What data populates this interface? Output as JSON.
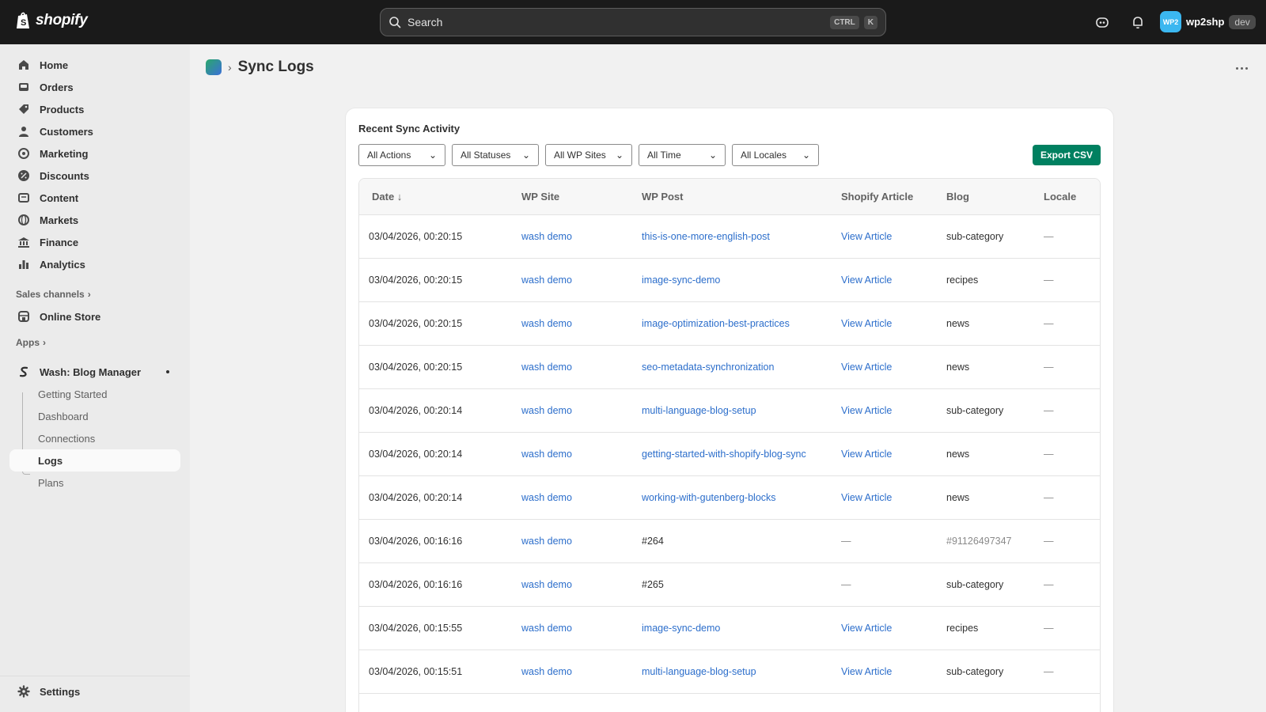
{
  "topbar": {
    "logo_text": "shopify",
    "search_placeholder": "Search",
    "shortcut_ctrl": "CTRL",
    "shortcut_key": "K",
    "avatar_text": "WP2",
    "store_name": "wp2shp",
    "env_badge": "dev"
  },
  "sidebar": {
    "items": [
      {
        "label": "Home",
        "icon": "home-icon"
      },
      {
        "label": "Orders",
        "icon": "orders-icon"
      },
      {
        "label": "Products",
        "icon": "tag-icon"
      },
      {
        "label": "Customers",
        "icon": "person-icon"
      },
      {
        "label": "Marketing",
        "icon": "target-icon"
      },
      {
        "label": "Discounts",
        "icon": "discount-icon"
      },
      {
        "label": "Content",
        "icon": "content-icon"
      },
      {
        "label": "Markets",
        "icon": "globe-icon"
      },
      {
        "label": "Finance",
        "icon": "bank-icon"
      },
      {
        "label": "Analytics",
        "icon": "bar-chart-icon"
      }
    ],
    "sales_channels_label": "Sales channels",
    "online_store_label": "Online Store",
    "apps_label": "Apps",
    "app_name": "Wash: Blog Manager",
    "app_subitems": [
      "Getting Started",
      "Dashboard",
      "Connections",
      "Logs",
      "Plans"
    ],
    "active_subitem": "Logs",
    "settings_label": "Settings"
  },
  "page": {
    "title": "Sync Logs",
    "breadcrumb_sep": "›"
  },
  "card": {
    "title": "Recent Sync Activity",
    "filters": [
      "All Actions",
      "All Statuses",
      "All WP Sites",
      "All Time",
      "All Locales"
    ],
    "export_label": "Export CSV"
  },
  "table": {
    "headers": [
      "Date ↓",
      "WP Site",
      "WP Post",
      "Shopify Article",
      "Blog",
      "Locale"
    ],
    "rows": [
      {
        "date": "03/04/2026, 00:20:15",
        "site": "wash demo",
        "post": "this-is-one-more-english-post",
        "post_link": true,
        "article": "View Article",
        "article_link": true,
        "blog": "sub-category",
        "locale": "—"
      },
      {
        "date": "03/04/2026, 00:20:15",
        "site": "wash demo",
        "post": "image-sync-demo",
        "post_link": true,
        "article": "View Article",
        "article_link": true,
        "blog": "recipes",
        "locale": "—"
      },
      {
        "date": "03/04/2026, 00:20:15",
        "site": "wash demo",
        "post": "image-optimization-best-practices",
        "post_link": true,
        "article": "View Article",
        "article_link": true,
        "blog": "news",
        "locale": "—"
      },
      {
        "date": "03/04/2026, 00:20:15",
        "site": "wash demo",
        "post": "seo-metadata-synchronization",
        "post_link": true,
        "article": "View Article",
        "article_link": true,
        "blog": "news",
        "locale": "—"
      },
      {
        "date": "03/04/2026, 00:20:14",
        "site": "wash demo",
        "post": "multi-language-blog-setup",
        "post_link": true,
        "article": "View Article",
        "article_link": true,
        "blog": "sub-category",
        "locale": "—"
      },
      {
        "date": "03/04/2026, 00:20:14",
        "site": "wash demo",
        "post": "getting-started-with-shopify-blog-sync",
        "post_link": true,
        "article": "View Article",
        "article_link": true,
        "blog": "news",
        "locale": "—"
      },
      {
        "date": "03/04/2026, 00:20:14",
        "site": "wash demo",
        "post": "working-with-gutenberg-blocks",
        "post_link": true,
        "article": "View Article",
        "article_link": true,
        "blog": "news",
        "locale": "—"
      },
      {
        "date": "03/04/2026, 00:16:16",
        "site": "wash demo",
        "post": "#264",
        "post_link": false,
        "article": "—",
        "article_link": false,
        "blog": "#91126497347",
        "blog_muted": true,
        "locale": "—"
      },
      {
        "date": "03/04/2026, 00:16:16",
        "site": "wash demo",
        "post": "#265",
        "post_link": false,
        "article": "—",
        "article_link": false,
        "blog": "sub-category",
        "locale": "—"
      },
      {
        "date": "03/04/2026, 00:15:55",
        "site": "wash demo",
        "post": "image-sync-demo",
        "post_link": true,
        "article": "View Article",
        "article_link": true,
        "blog": "recipes",
        "locale": "—"
      },
      {
        "date": "03/04/2026, 00:15:51",
        "site": "wash demo",
        "post": "multi-language-blog-setup",
        "post_link": true,
        "article": "View Article",
        "article_link": true,
        "blog": "sub-category",
        "locale": "—"
      }
    ]
  },
  "colors": {
    "topbar_bg": "#1a1a1a",
    "link": "#2c6ecb",
    "primary_button": "#008060"
  }
}
